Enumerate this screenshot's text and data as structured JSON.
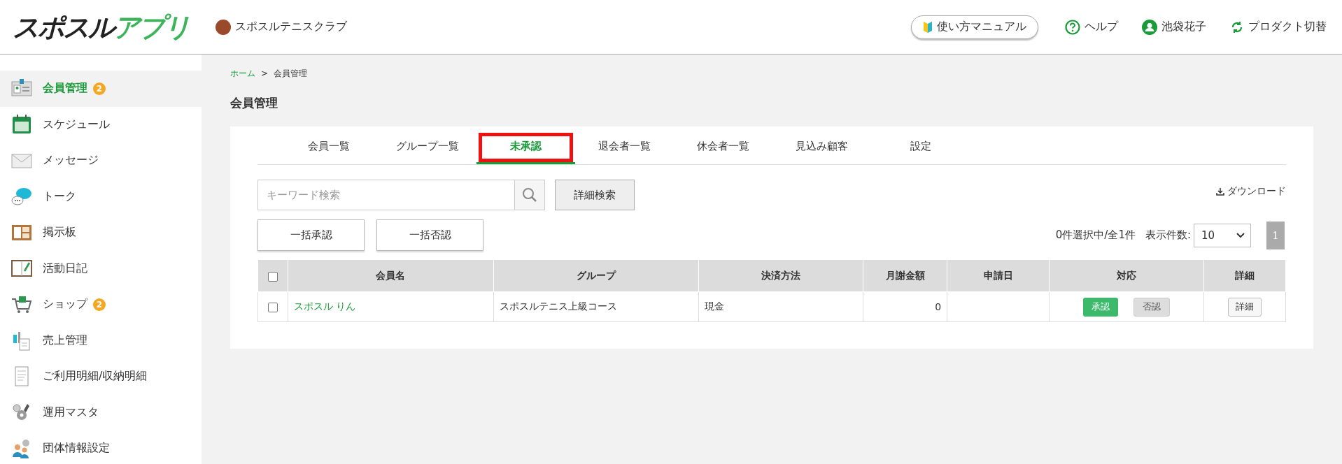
{
  "header": {
    "logo_main": "スポスル",
    "logo_accent": "アプリ",
    "club": "スポスルテニスクラブ",
    "manual_button": "使い方マニュアル",
    "help": "ヘルプ",
    "user": "池袋花子",
    "product_switch": "プロダクト切替"
  },
  "sidebar": {
    "items": [
      {
        "label": "会員管理",
        "badge": "2",
        "selected": true
      },
      {
        "label": "スケジュール",
        "selected": false
      },
      {
        "label": "メッセージ",
        "selected": false
      },
      {
        "label": "トーク",
        "selected": false
      },
      {
        "label": "掲示板",
        "selected": false
      },
      {
        "label": "活動日記",
        "selected": false
      },
      {
        "label": "ショップ",
        "badge": "2",
        "selected": false
      },
      {
        "label": "売上管理",
        "selected": false
      },
      {
        "label": "ご利用明細/収納明細",
        "selected": false
      },
      {
        "label": "運用マスタ",
        "selected": false
      },
      {
        "label": "団体情報設定",
        "selected": false
      }
    ]
  },
  "breadcrumb": {
    "home": "ホーム",
    "separator": ">",
    "current": "会員管理"
  },
  "page_title": "会員管理",
  "tabs": [
    {
      "label": "会員一覧",
      "selected": false,
      "highlighted": false
    },
    {
      "label": "グループ一覧",
      "selected": false,
      "highlighted": false
    },
    {
      "label": "未承認",
      "selected": true,
      "highlighted": true
    },
    {
      "label": "退会者一覧",
      "selected": false,
      "highlighted": false
    },
    {
      "label": "休会者一覧",
      "selected": false,
      "highlighted": false
    },
    {
      "label": "見込み顧客",
      "selected": false,
      "highlighted": false
    },
    {
      "label": "設定",
      "selected": false,
      "highlighted": false
    }
  ],
  "search": {
    "placeholder": "キーワード検索",
    "detail_button": "詳細検索"
  },
  "download": "ダウンロード",
  "bulk_buttons": [
    "一括承認",
    "一括否認"
  ],
  "selection_status": "0件選択中/全1件",
  "page_size": {
    "label": "表示件数:",
    "value": "10"
  },
  "pagination": [
    {
      "label": "1",
      "selected": true
    }
  ],
  "table": {
    "header_checked": false,
    "columns": [
      "会員名",
      "グループ",
      "決済方法",
      "月謝金額",
      "申請日",
      "対応",
      "詳細"
    ],
    "rows": [
      {
        "checked": false,
        "name": "スポスル りん",
        "group": "スポスルテニス上級コース",
        "payment": "現金",
        "monthly_fee": "0",
        "approve": "承認",
        "reject": "否認",
        "detail": "詳細"
      }
    ]
  }
}
